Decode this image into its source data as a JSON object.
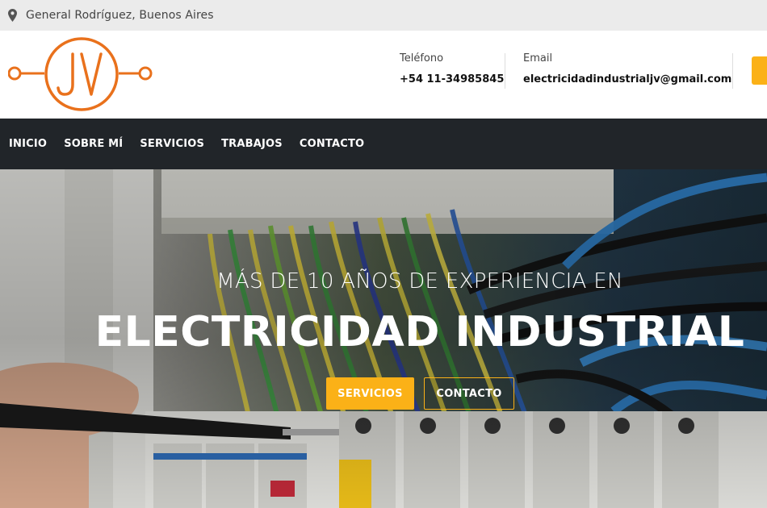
{
  "topbar": {
    "location": "General Rodríguez, Buenos Aires",
    "location_icon": "map-pin-icon"
  },
  "header": {
    "logo_text": "JV",
    "phone": {
      "label": "Teléfono",
      "value": "+54 11-34985845"
    },
    "email": {
      "label": "Email",
      "value": "electricidadindustrialjv@gmail.com"
    }
  },
  "nav": {
    "items": [
      "INICIO",
      "SOBRE MÍ",
      "SERVICIOS",
      "TRABAJOS",
      "CONTACTO"
    ]
  },
  "hero": {
    "subtitle": "MÁS DE 10 AÑOS DE EXPERIENCIA EN",
    "title": "ELECTRICIDAD INDUSTRIAL",
    "primary_button": "SERVICIOS",
    "secondary_button": "CONTACTO"
  },
  "colors": {
    "accent": "#fbb117",
    "logo_orange": "#e9711c",
    "nav_bg": "#212529",
    "topbar_bg": "#ebebeb"
  }
}
